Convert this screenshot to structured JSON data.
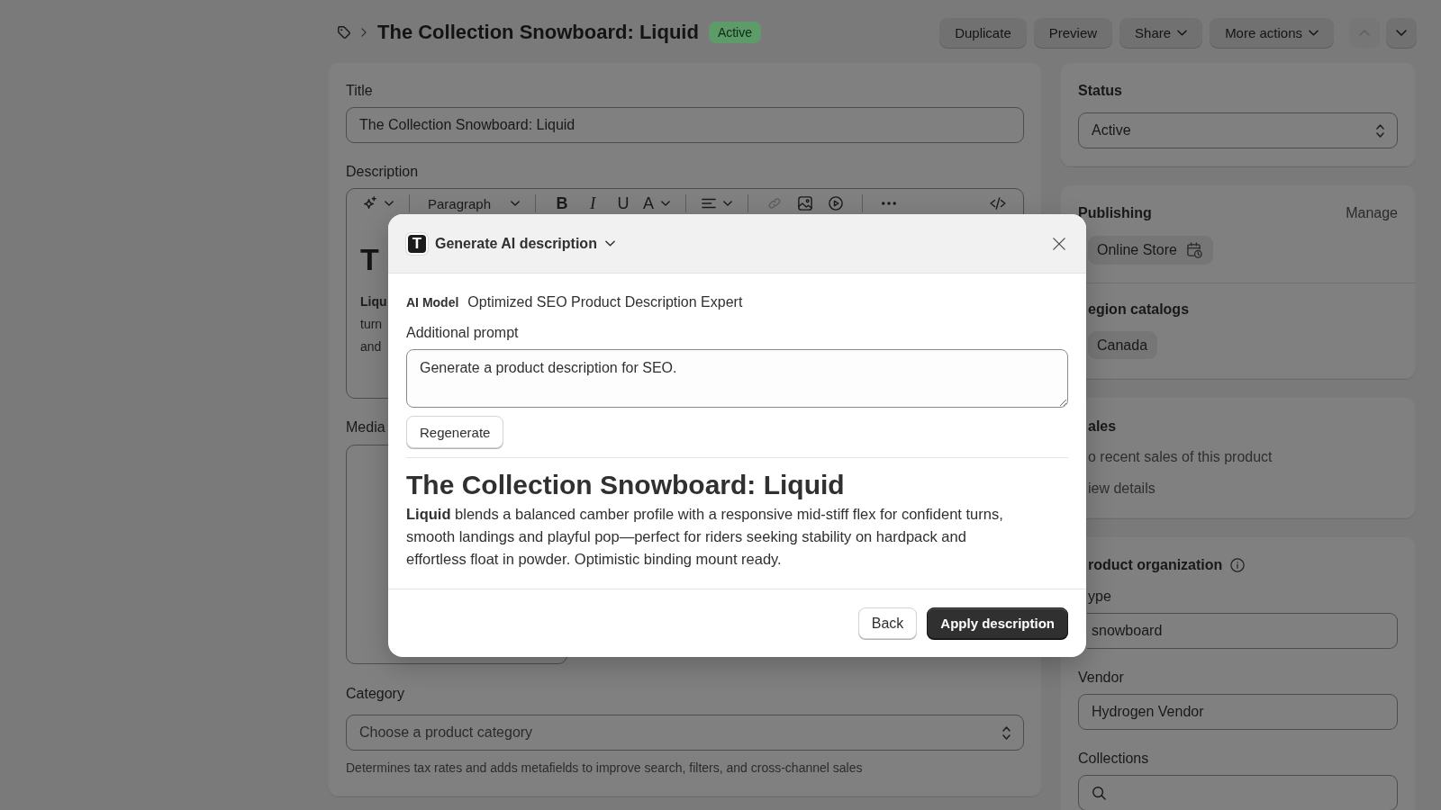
{
  "header": {
    "title": "The Collection Snowboard: Liquid",
    "status_badge": "Active",
    "actions": [
      {
        "label": "Duplicate",
        "kind": "button"
      },
      {
        "label": "Preview",
        "kind": "button"
      },
      {
        "label": "Share",
        "kind": "menu"
      },
      {
        "label": "More actions",
        "kind": "menu"
      }
    ],
    "pager": [
      {
        "kind": "previous",
        "disabled": true
      },
      {
        "kind": "next",
        "disabled": false
      }
    ]
  },
  "product": {
    "title_label": "Title",
    "title_value": "The Collection Snowboard: Liquid",
    "description_label": "Description",
    "editor": {
      "toolbar_groups": [
        [
          {
            "kind": "ai",
            "caret": true,
            "disabled": false
          }
        ],
        [
          {
            "kind": "select",
            "label": "Paragraph",
            "caret": true,
            "disabled": false
          }
        ],
        [
          {
            "kind": "bold",
            "glyph": "B",
            "caret": false,
            "disabled": false
          },
          {
            "kind": "italic",
            "glyph": "I",
            "caret": false,
            "disabled": false
          },
          {
            "kind": "underline",
            "glyph": "U",
            "caret": false,
            "disabled": false
          },
          {
            "kind": "color",
            "glyph": "A",
            "caret": true,
            "disabled": false
          }
        ],
        [
          {
            "kind": "align",
            "caret": true,
            "disabled": false
          }
        ],
        [
          {
            "kind": "link",
            "caret": false,
            "disabled": true
          },
          {
            "kind": "image",
            "caret": false,
            "disabled": false
          },
          {
            "kind": "video",
            "caret": false,
            "disabled": false
          }
        ],
        [
          {
            "kind": "more",
            "caret": false,
            "disabled": false
          }
        ]
      ],
      "toolbar_end": [
        {
          "kind": "code",
          "caret": false,
          "disabled": false
        }
      ],
      "heading": "T",
      "lines": [
        {
          "text": "Liqu",
          "bold": true
        },
        {
          "text": "turn",
          "bold": false
        },
        {
          "text": "and",
          "bold": false
        }
      ]
    },
    "media_label": "Media",
    "category_label": "Category",
    "category_placeholder": "Choose a product category",
    "category_help": "Determines tax rates and adds metafields to improve search, filters, and cross-channel sales"
  },
  "status": {
    "title": "Status",
    "value": "Active"
  },
  "publishing": {
    "title": "Publishing",
    "action": "Manage",
    "channels": [
      "Online Store"
    ],
    "catalogs_title": "egion catalogs",
    "catalogs": [
      "Canada"
    ]
  },
  "sales": {
    "title": "ales",
    "message": "o recent sales of this product",
    "link": "iew details"
  },
  "organization": {
    "title": "roduct organization",
    "fields": [
      {
        "label": "ype",
        "kind": "text",
        "value": "snowboard"
      },
      {
        "label": "Vendor",
        "kind": "text",
        "value": "Hydrogen Vendor"
      },
      {
        "label": "Collections",
        "kind": "search"
      }
    ]
  },
  "modal": {
    "app_glyph": "T",
    "title": "Generate AI description",
    "model_label": "AI Model",
    "model_value": "Optimized SEO Product Description Expert",
    "prompt_label": "Additional prompt",
    "prompt_value": "Generate a product description for SEO.",
    "regenerate_label": "Regenerate",
    "result_heading": "The Collection Snowboard: Liquid",
    "result_body": "**Liquid** blends a balanced camber profile with a responsive mid-stiff flex for confident turns, smooth landings and playful pop—perfect for riders seeking stability on hardpack and effortless float in powder. Optimistic binding mount ready.",
    "buttons": [
      {
        "label": "Back",
        "kind": "secondary"
      },
      {
        "label": "Apply description",
        "kind": "primary"
      }
    ]
  }
}
